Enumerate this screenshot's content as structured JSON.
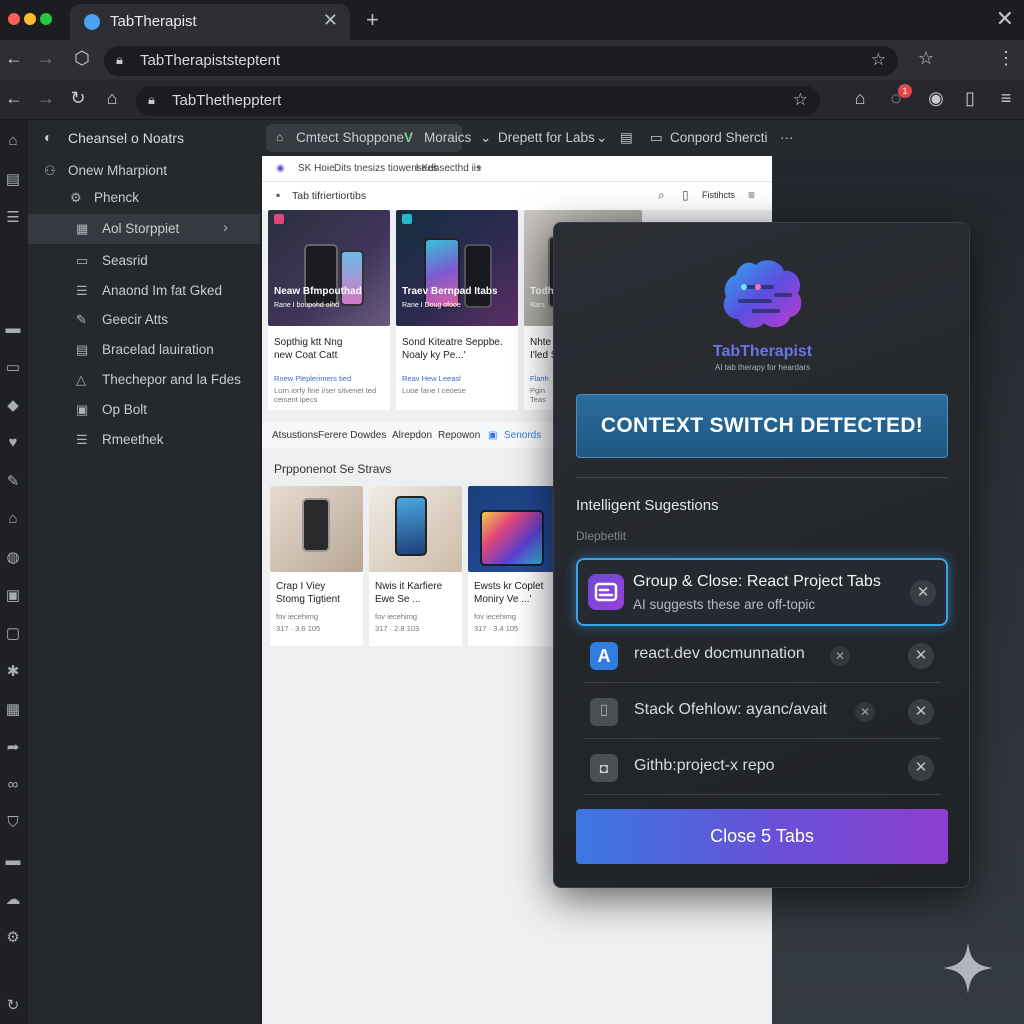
{
  "browser": {
    "tab_title": "TabTherapist",
    "tab_close": "✕",
    "new_tab": "+",
    "window_close": "✕",
    "url_primary": "TabTheraріststeptent",
    "url_secondary": "TabThethepptert",
    "notification_count": "1",
    "colors": {
      "window_red": "#ff5f57",
      "window_yellow": "#febc2e",
      "window_green": "#28c840"
    }
  },
  "sidebar": {
    "header": "Cheansel o Noatrs",
    "items": [
      {
        "label": "Onew Mharpiont"
      },
      {
        "label": "Phenck"
      },
      {
        "label": "Aol Storppiet"
      },
      {
        "label": "Seasrid"
      },
      {
        "label": "Anaond Im fat Gked"
      },
      {
        "label": "Geecir Atts"
      },
      {
        "label": "Bracelad lauiration"
      },
      {
        "label": "Thechepor and la Fdes"
      },
      {
        "label": "Op Bolt"
      },
      {
        "label": "Rmeethek"
      }
    ]
  },
  "bookmarks": [
    {
      "label": "Cmtect Shoppone"
    },
    {
      "label": "Moraics"
    },
    {
      "label": "Drepett for Labs"
    },
    {
      "label": "Conpord Shercti"
    },
    {
      "label": "···"
    }
  ],
  "page": {
    "top_items": [
      "SK Hoie",
      "Dits tnesizs tiowensees",
      "l-Kdhsecthd iis",
      "+"
    ],
    "header_title": "Tab tifriertiortibs",
    "header_action": "Fistihcts",
    "cards": [
      {
        "caption": "Neaw Bfmpouthad",
        "caption_sub": "Rane I boupohd oihd",
        "title": "Sopthig ktt Nng\nnew Coat Catt",
        "link": "Rnew Pleplerimers tied",
        "meta": "Lurn iorfy fine i/ser sitvenet ted\nceisent ipecs"
      },
      {
        "caption": "Traev Bernpad Itabs",
        "caption_sub": "Rane I Doug ofooe",
        "title": "Sond Kiteatre Seppbe.\nNoaly ky Pe...'",
        "link": "Reav Hew Leeasl",
        "meta": "Luoe fane I ceoese\n"
      },
      {
        "caption": "Todh",
        "caption_sub": "Rars",
        "title": "Nhte\nI'led S",
        "link": "Flanh",
        "meta": "Pgin\nTeas"
      }
    ],
    "filters": [
      "Atsustions",
      "Ferere Dowdes",
      "Alrepdon",
      "Repowon",
      "Senords"
    ],
    "section_title": "Prpponenot Se Stravs",
    "bottom_cards": [
      {
        "title": "Crap I Viey\nStomg Tigtient",
        "meta": "fov iecehimg",
        "price": "317 · 3.6 105"
      },
      {
        "title": "Nwis it Karfiere\nEwe Se ...",
        "meta": "fov iecehimg",
        "price": "317 · 2.8 103"
      },
      {
        "title": "Ewsts kr Coplet\nMoniry Ve ...'",
        "meta": "fov iecehimg",
        "price": "317 · 3.4 105"
      }
    ]
  },
  "popup": {
    "brand": "TabTherapist",
    "tagline": "AI tab therapy for heardars",
    "alert": "CONTEXT SWITCH DETECTED!",
    "suggestions_title": "Intelligent Sugestions",
    "suggestions_sub": "Dlepbetlit",
    "highlight": {
      "title": "Group & Close: React Project Tabs",
      "subtitle": "AI suggests these are off-topic"
    },
    "tabs": [
      {
        "label": "react.dev docmunnation",
        "icon": "react-a-icon",
        "color": "#2f7de1"
      },
      {
        "label": "Stack Ofehlow: ayanc/avait",
        "icon": "stack-icon",
        "color": "#4a4e55"
      },
      {
        "label": "Githb:project-x repo",
        "icon": "github-icon",
        "color": "#4a4e55"
      }
    ],
    "close_button": "Close 5 Tabs",
    "close_glyph": "✕"
  }
}
